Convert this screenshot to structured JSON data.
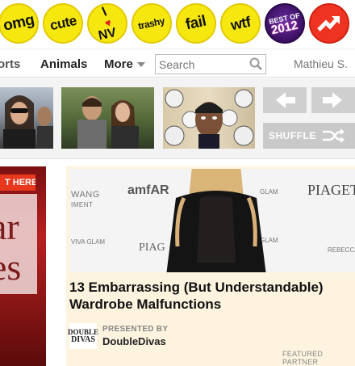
{
  "badges": {
    "omg": "omg",
    "cute": "cute",
    "lnv_top": "l",
    "lnv_bottom": "NV",
    "trashy": "trashy",
    "fail": "fail",
    "wtf": "wtf",
    "best_top": "BEST OF",
    "best_year": "2012"
  },
  "nav": {
    "sports": "orts",
    "animals": "Animals",
    "more": "More",
    "search_placeholder": "Search",
    "user": "Mathieu S."
  },
  "thumbnails": {
    "shuffle_label": "SHUFFLE"
  },
  "left_ad": {
    "tag": "T HERE",
    "line1": "ar",
    "line2": "es"
  },
  "card": {
    "image_logos": {
      "wang": "WANG",
      "wang_sub": "IMENT",
      "amfar": "amfAR",
      "glam": "GLAM",
      "piaget": "PIAGET",
      "viva_glam": "VIVA GLAM",
      "piaget_small": "PIAG",
      "rebecca": "REBECCA"
    },
    "title": "13 Embarrassing (But Understandable) Wardrobe Malfunctions",
    "sponsor_logo_top": "DOUBLE",
    "sponsor_logo_bottom": "DIVAS",
    "presented_by": "PRESENTED BY",
    "sponsor_name": "DoubleDivas",
    "featured": "FEATURED PARTNER"
  },
  "colors": {
    "badge_yellow": "#f6e80f",
    "trending_red": "#ee3322",
    "card_bg": "#fdf3de",
    "arrow_gray": "#cfcfcf"
  }
}
